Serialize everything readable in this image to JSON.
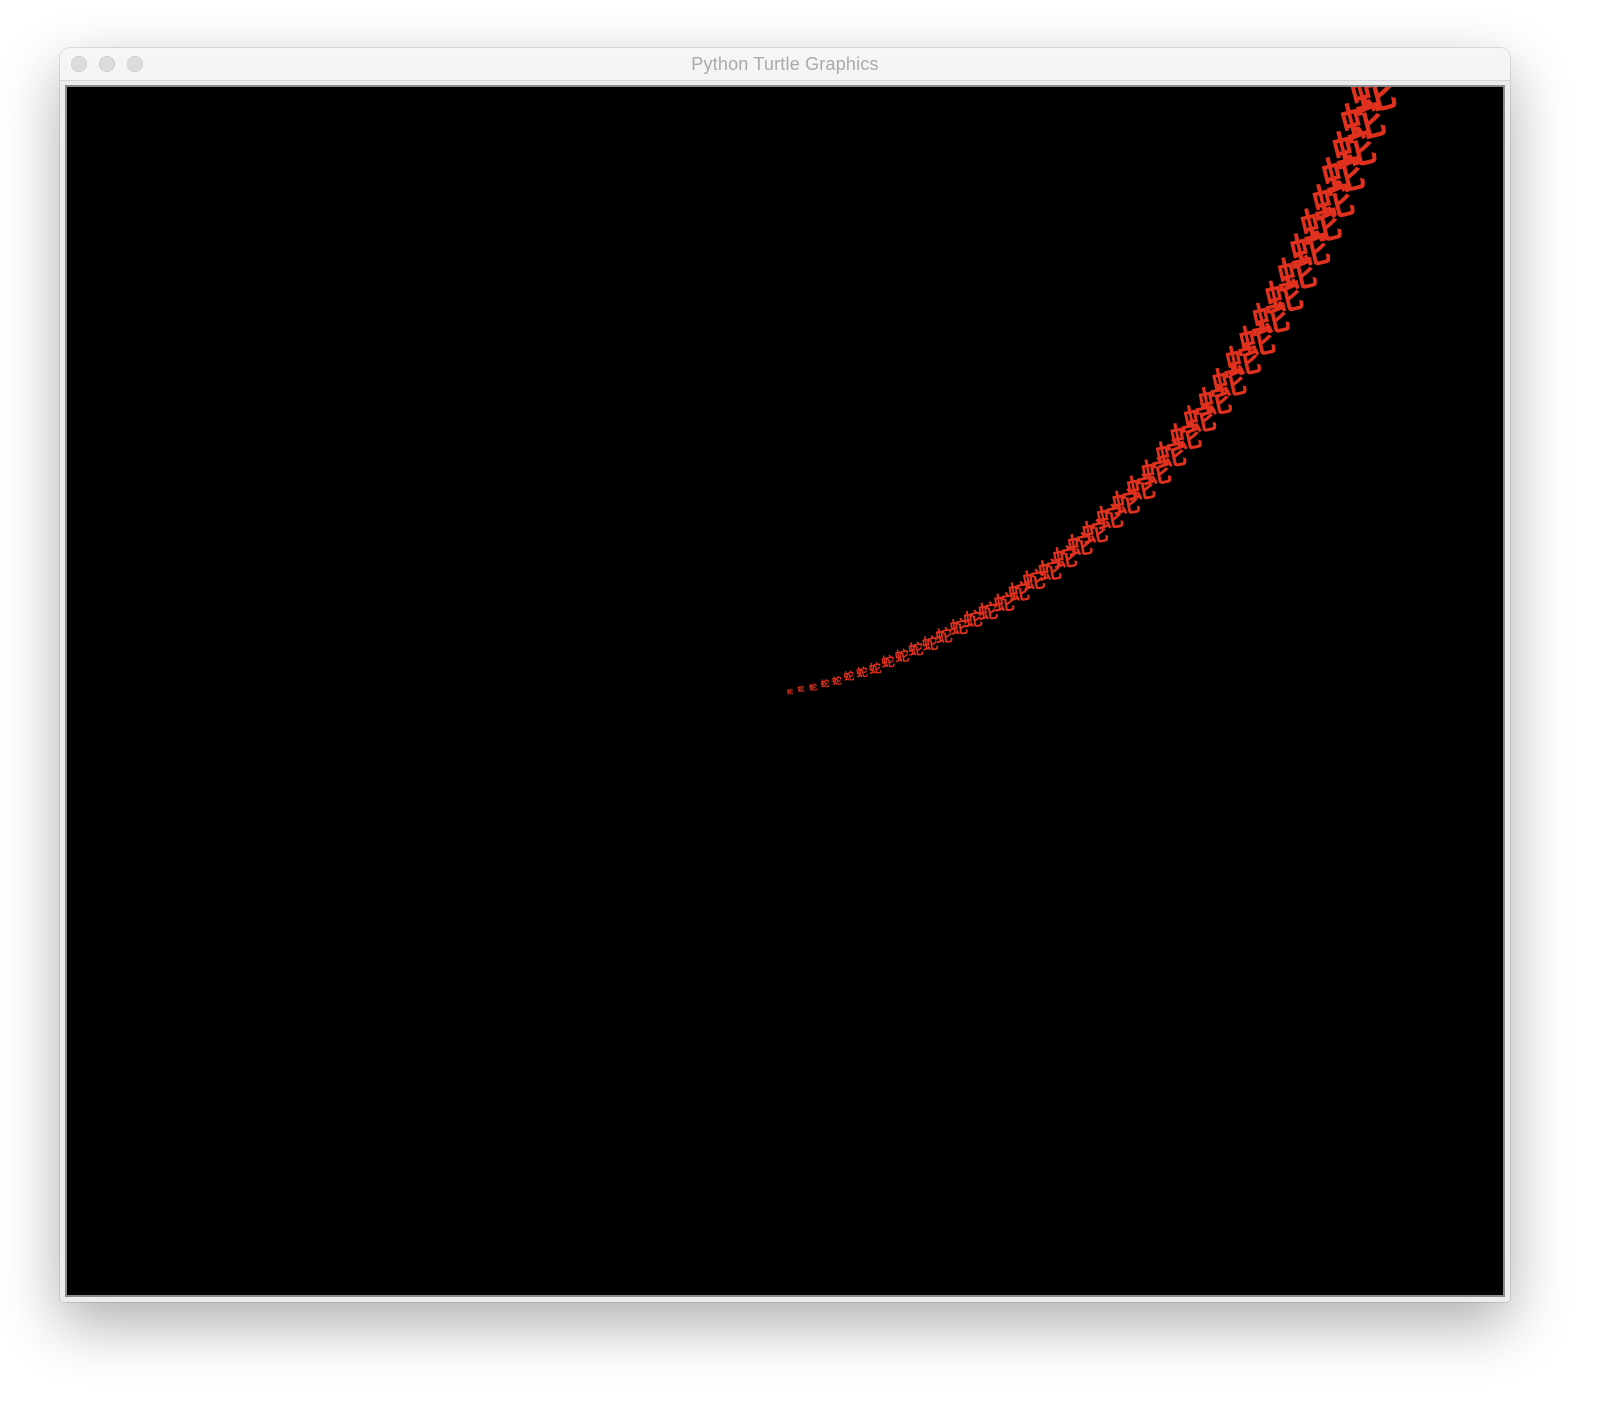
{
  "window": {
    "title": "Python Turtle Graphics"
  },
  "canvas": {
    "background": "#000000",
    "stamp_text": "蛇",
    "stamp_color": "#e0301e",
    "stamp_count": 44
  }
}
